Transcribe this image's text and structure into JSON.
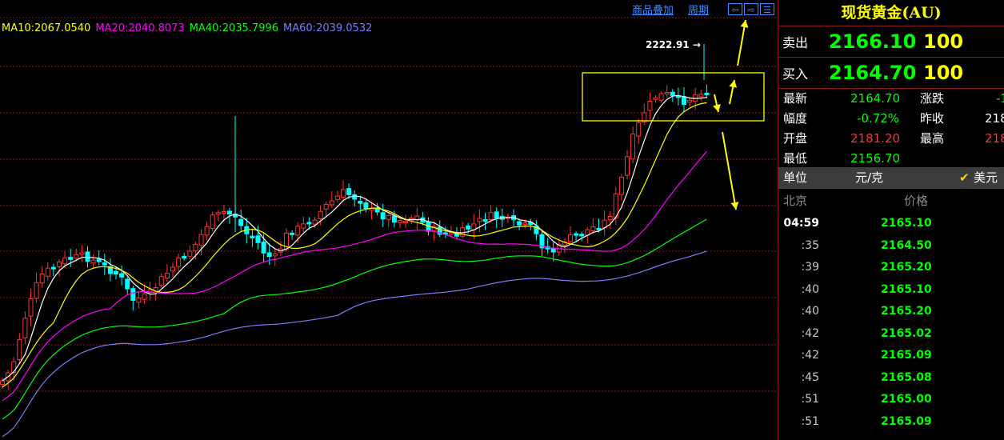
{
  "toolbar": {
    "overlay_label": "商品叠加",
    "period_label": "周期",
    "nav_left": "⇦",
    "nav_right": "⇨",
    "nav_layout": "☰"
  },
  "ma_legend": [
    {
      "label": "MA10:2067.0540",
      "color": "#ffff00"
    },
    {
      "label": "MA20:2040.8073",
      "color": "#ff00ff"
    },
    {
      "label": "MA40:2035.7996",
      "color": "#00ff00"
    },
    {
      "label": "MA60:2039.0532",
      "color": "#7b7bff"
    }
  ],
  "peak_label": "2222.91",
  "quote": {
    "title": "现货黄金(AU)",
    "sell": {
      "label": "卖出",
      "price": "2166.10",
      "qty": "100"
    },
    "buy": {
      "label": "买入",
      "price": "2164.70",
      "qty": "100"
    },
    "info": [
      {
        "label": "最新",
        "value": "2164.70",
        "label2": "涨跌",
        "value2": "-1"
      },
      {
        "label": "幅度",
        "value": "-0.72%",
        "label2": "昨收",
        "value2": "218"
      },
      {
        "label": "开盘",
        "value": "2181.20",
        "label2": "最高",
        "value2": "218"
      },
      {
        "label": "最低",
        "value": "2156.70",
        "label2": "",
        "value2": ""
      }
    ],
    "unit_label": "单位",
    "unit_value": "元/克",
    "currency_check": "✔",
    "currency_label": "美元",
    "ticks_header_time": "北京",
    "ticks_header_price": "价格",
    "ticks": [
      {
        "time": "04:59",
        "price": "2165.10"
      },
      {
        "time": ":35",
        "price": "2164.50"
      },
      {
        "time": ":39",
        "price": "2165.20"
      },
      {
        "time": ":40",
        "price": "2165.10"
      },
      {
        "time": ":40",
        "price": "2165.20"
      },
      {
        "time": ":42",
        "price": "2165.02"
      },
      {
        "time": ":42",
        "price": "2165.09"
      },
      {
        "time": ":45",
        "price": "2165.08"
      },
      {
        "time": ":51",
        "price": "2165.00"
      },
      {
        "time": ":51",
        "price": "2165.09"
      }
    ]
  },
  "colors": {
    "up": "#ff3333",
    "down": "#00ffff",
    "ma5": "#ffffff",
    "ma10": "#ffff00",
    "ma20": "#ff00ff",
    "ma40": "#00ff00",
    "ma60": "#7b7bff",
    "grid": "#8a1515",
    "annotation": "#ffff00"
  }
}
